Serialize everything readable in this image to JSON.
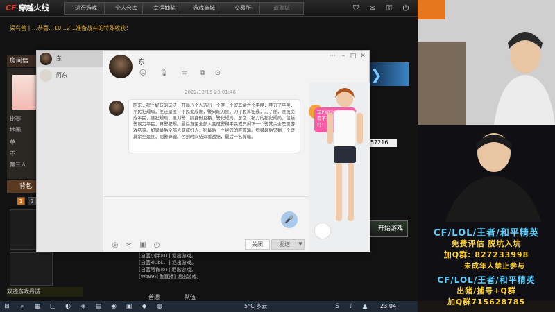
{
  "game": {
    "logo_badge": "CF",
    "logo_text": "穿越火线",
    "nav_tabs": [
      "进行游戏",
      "个人仓库",
      "幸运抽奖",
      "游戏商城",
      "交易所",
      "道聚城"
    ],
    "marquee": "渠鸟营丨…恭喜…10…2…准备战斗的特殊收获！",
    "room_info_label": "房间信",
    "left_panel_items": [
      "比赛",
      "地图",
      "单",
      "不",
      "第三人"
    ],
    "backpack_label": "背包",
    "pages": [
      "1",
      "2"
    ],
    "score_text": "57216",
    "start_game_label": "开始游戏",
    "bottom_left_text": "双迹游戏丹诚",
    "chat_lines": [
      "[自蓝小胖TuT] 退出游戏。",
      "[自蓝xiubi… ] 退出游戏。",
      "[自蓝阿肯ToT] 退出游戏。",
      "[Wo99斗鱼直播] 退出游戏。"
    ],
    "bottom_tabs": [
      "普通",
      "队伍"
    ]
  },
  "chat": {
    "contacts": [
      {
        "name": "东"
      },
      {
        "name": "阿东"
      }
    ],
    "header_name": "东",
    "timestamp": "2022/12/15 23:01:46",
    "message": "阿东，提个好玩的玩法，开局八个人选出一个匪一个警其余六个平民，匪刀了平民，平民犯规局，匪还是匪，平民变成匪，警只能刀匪，刀平民算犯规，刀了匪，匪被变成平民，匪犯规局，匪刀警，则身份互换，警犯规局。总之，被刀的都犯规局，包括警误刀平民，算警犯规。最后直至全部人变成警和平民或只剩下一个警其余全是匪游戏结束。如果最后全部人变成好人，则最后一个被刀的匪算输。如果最后只剩一个警其余全是匪，则警算输。否则时间结束看战绩，最后一名算输。",
    "close_label": "关闭",
    "send_label": "发送",
    "avatar_bubble": "玩PK的战！我中有不秀一点最花吧打！"
  },
  "promo": {
    "line1": "CF/LOL/王者/和平精英",
    "line2": "免费评估  脱坑入坑",
    "line3": "加Q群: 827233998",
    "line4": "未成年人禁止参与",
    "line5": "CF/LOL/王者/和平精英",
    "line6": "出猪/捕号+Q群",
    "line7": "加Q群715628785"
  },
  "taskbar": {
    "weather": "5°C 多云",
    "time": "23:04"
  },
  "colors": {
    "cf_red": "#e03a1e",
    "promo_cyan": "#5fd0ff",
    "promo_yellow": "#ffd22e",
    "avatar_bubble_pink": "#ff5aa6"
  }
}
